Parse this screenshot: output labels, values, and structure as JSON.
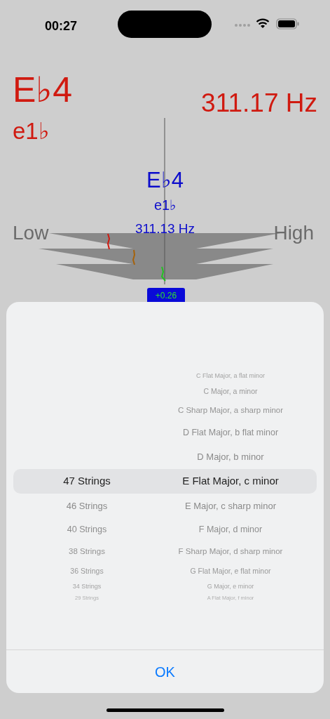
{
  "status_bar": {
    "time": "00:27"
  },
  "detected": {
    "note": "E♭4",
    "note_alt": "e1♭",
    "frequency": "311.17 Hz"
  },
  "tuner": {
    "note": "E♭4",
    "note_alt": "e1♭",
    "frequency": "311.13 Hz",
    "low_label": "Low",
    "high_label": "High",
    "offset": "+0.26"
  },
  "picker": {
    "rows": [
      {
        "key": "C Flat Major, a flat minor",
        "selected": false
      },
      {
        "key": "C Major, a minor",
        "selected": false
      },
      {
        "key": "C Sharp Major, a sharp minor",
        "selected": false
      },
      {
        "key": "D Flat Major, b flat minor",
        "selected": false
      },
      {
        "key": "D Major, b minor",
        "selected": false
      },
      {
        "strings": "47 Strings",
        "key": "E Flat Major, c minor",
        "selected": true
      },
      {
        "strings": "46 Strings",
        "key": "E Major, c sharp minor",
        "selected": false
      },
      {
        "strings": "40 Strings",
        "key": "F Major, d minor",
        "selected": false
      },
      {
        "strings": "38 Strings",
        "key": "F Sharp Major, d sharp minor",
        "selected": false
      },
      {
        "strings": "36 Strings",
        "key": "G Flat Major, e flat minor",
        "selected": false
      },
      {
        "strings": "34 Strings",
        "key": "G Major, e minor",
        "selected": false
      },
      {
        "strings": "29 Strings",
        "key": "A Flat Major, f minor",
        "selected": false
      }
    ]
  },
  "ok_button": {
    "label": "OK"
  }
}
